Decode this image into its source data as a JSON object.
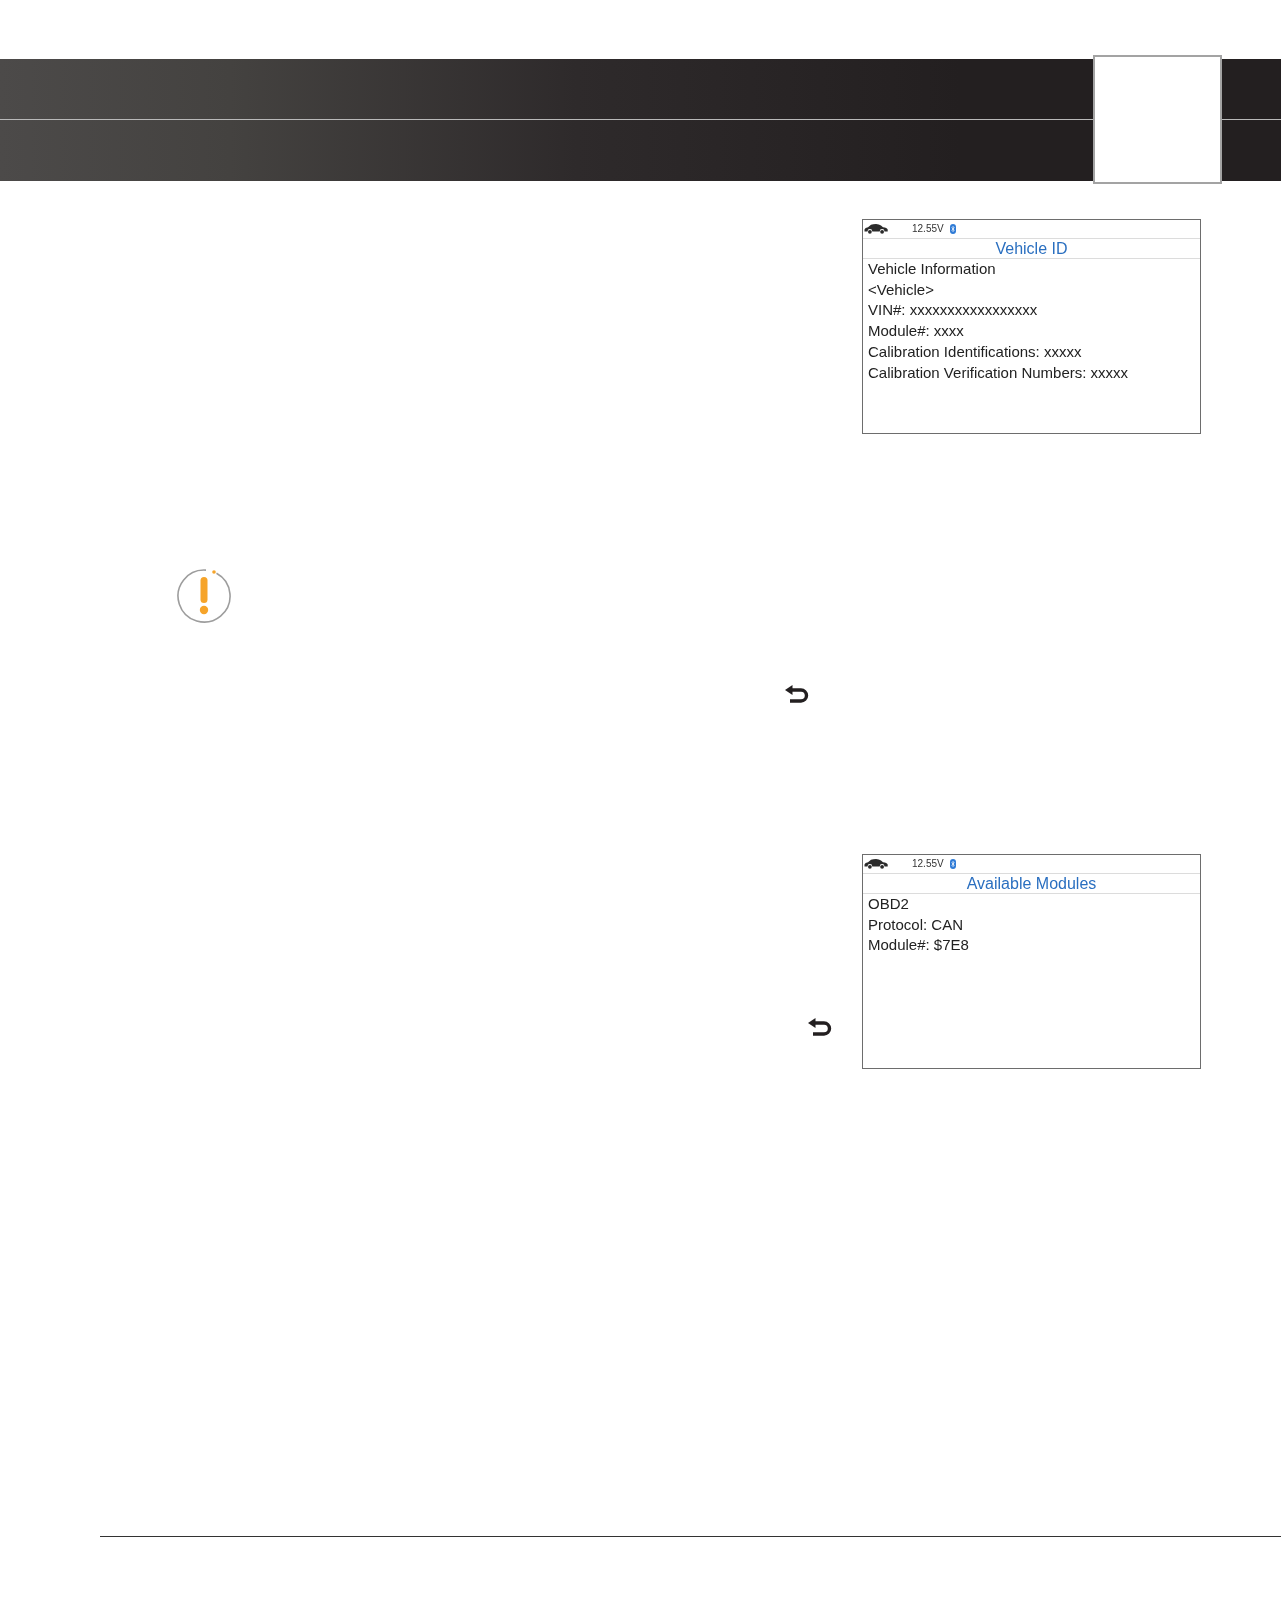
{
  "screens": [
    {
      "voltage": "12.55V",
      "title": "Vehicle ID",
      "lines": [
        "Vehicle Information",
        "<Vehicle>",
        "VIN#: xxxxxxxxxxxxxxxxx",
        "Module#: xxxx",
        "Calibration Identifications: xxxxx",
        "Calibration Verification Numbers: xxxxx"
      ]
    },
    {
      "voltage": "12.55V",
      "title": "Available Modules",
      "lines": [
        "OBD2",
        "Protocol: CAN",
        "Module#: $7E8"
      ]
    }
  ]
}
